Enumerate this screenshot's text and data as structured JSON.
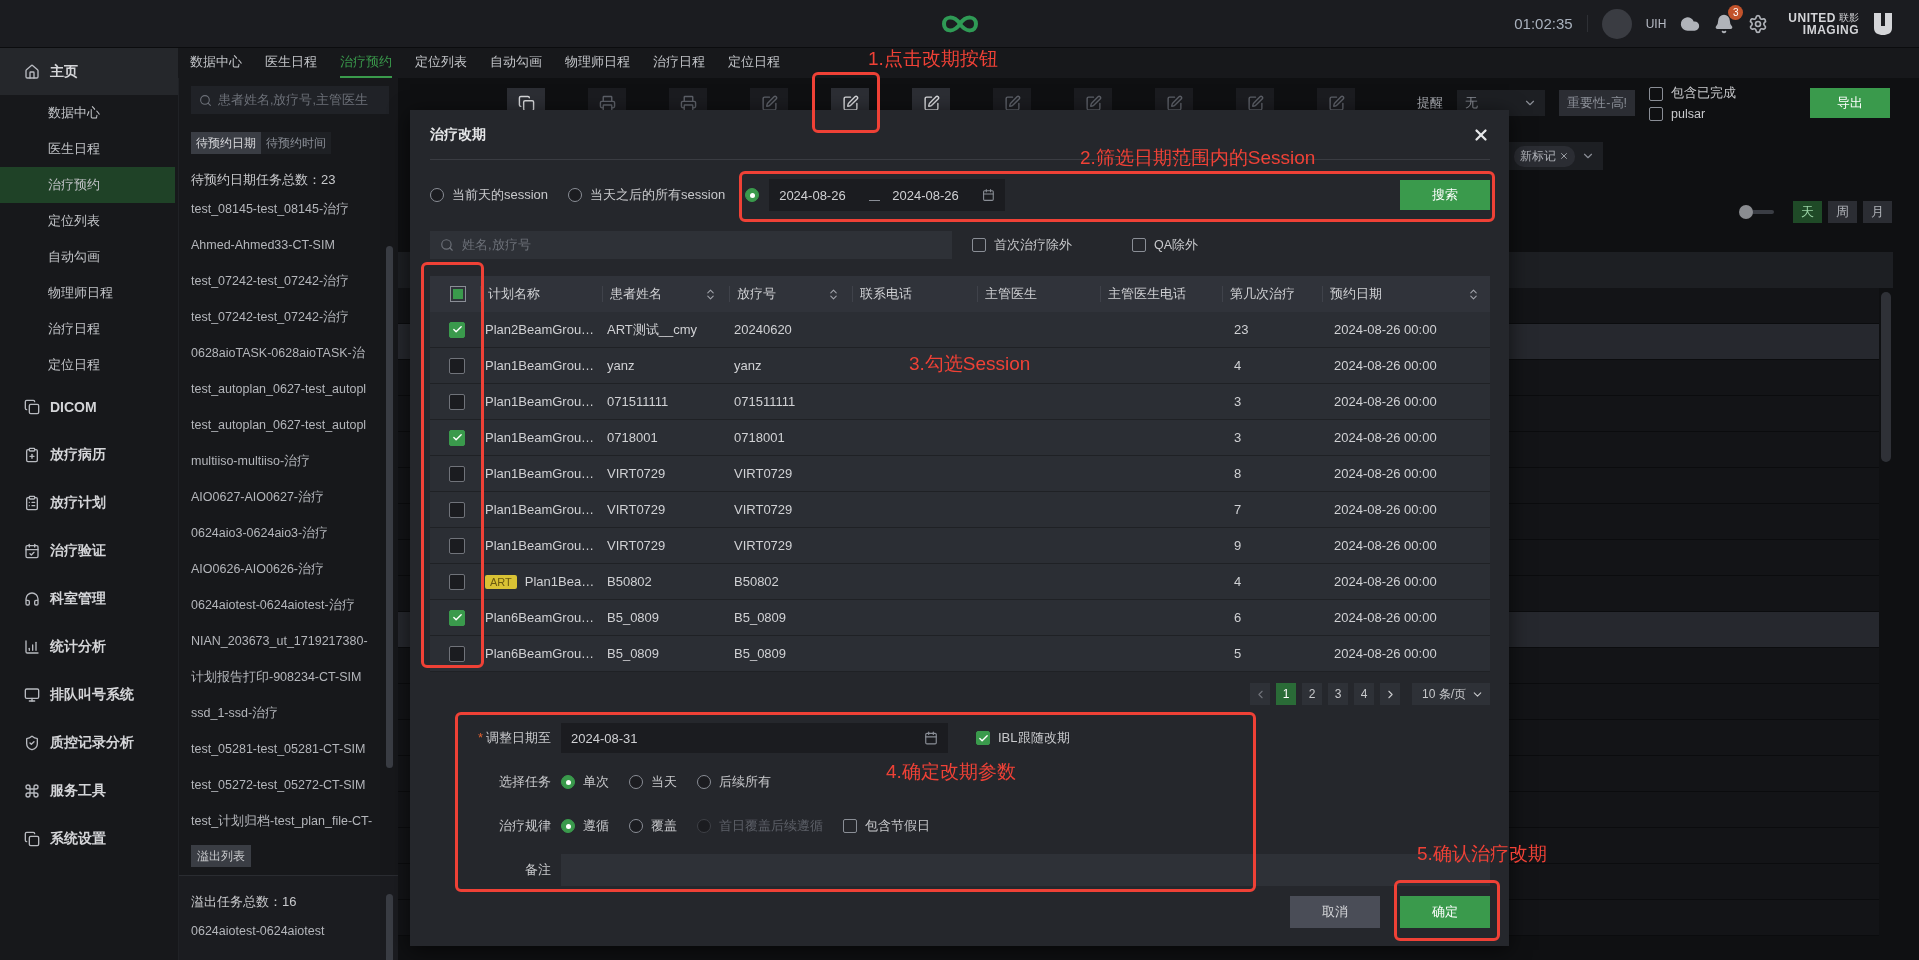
{
  "top_bar": {
    "time": "01:02:35",
    "user": "UIH",
    "notification_count": "3",
    "brand": {
      "line_1": "UNITED",
      "line_1_cn": "联影",
      "line_2": "IMAGING"
    }
  },
  "sidebar": {
    "sections": [
      {
        "label": "主页",
        "expanded": true,
        "children": [
          {
            "label": "数据中心",
            "selected": false
          },
          {
            "label": "医生日程",
            "selected": false
          },
          {
            "label": "治疗预约",
            "selected": true
          },
          {
            "label": "定位列表",
            "selected": false
          },
          {
            "label": "自动勾画",
            "selected": false
          },
          {
            "label": "物理师日程",
            "selected": false
          },
          {
            "label": "治疗日程",
            "selected": false
          },
          {
            "label": "定位日程",
            "selected": false
          }
        ]
      },
      {
        "label": "DICOM",
        "expanded": false
      },
      {
        "label": "放疗病历",
        "expanded": false
      },
      {
        "label": "放疗计划",
        "expanded": false
      },
      {
        "label": "治疗验证",
        "expanded": false
      },
      {
        "label": "科室管理",
        "expanded": false
      },
      {
        "label": "统计分析",
        "expanded": false
      },
      {
        "label": "排队叫号系统",
        "expanded": false
      },
      {
        "label": "质控记录分析",
        "expanded": false
      },
      {
        "label": "服务工具",
        "expanded": false
      },
      {
        "label": "系统设置",
        "expanded": false
      }
    ]
  },
  "module_tabs": [
    {
      "label": "数据中心",
      "selected": false
    },
    {
      "label": "医生日程",
      "selected": false
    },
    {
      "label": "治疗预约",
      "selected": true
    },
    {
      "label": "定位列表",
      "selected": false
    },
    {
      "label": "自动勾画",
      "selected": false
    },
    {
      "label": "物理师日程",
      "selected": false
    },
    {
      "label": "治疗日程",
      "selected": false
    },
    {
      "label": "定位日程",
      "selected": false
    }
  ],
  "queue": {
    "search_placeholder": "患者姓名,放疗号,主管医生",
    "tabs": [
      {
        "label": "待预约日期",
        "selected": true
      },
      {
        "label": "待预约时间",
        "selected": false
      }
    ],
    "count_label": "待预约日期任务总数：23",
    "items": [
      "test_08145-test_08145-治疗",
      "Ahmed-Ahmed33-CT-SIM",
      "test_07242-test_07242-治疗",
      "test_07242-test_07242-治疗",
      "0628aioTASK-0628aioTASK-治",
      "test_autoplan_0627-test_autopl",
      "test_autoplan_0627-test_autopl",
      "multiiso-multiiso-治疗",
      "AIO0627-AIO0627-治疗",
      "0624aio3-0624aio3-治疗",
      "AIO0626-AIO0626-治疗",
      "0624aiotest-0624aiotest-治疗",
      "NIAN_203673_ut_1719217380-",
      "计划报告打印-908234-CT-SIM",
      "ssd_1-ssd-治疗",
      "test_05281-test_05281-CT-SIM",
      "test_05272-test_05272-CT-SIM",
      "test_计划归档-test_plan_file-CT-"
    ],
    "overflow_button": "溢出列表",
    "overflow_count": "溢出任务总数：16",
    "overflow_items": [
      "0624aiotest-0624aiotest"
    ]
  },
  "toolbar": {
    "buttons": [
      {
        "kind": "copy",
        "disabled": false
      },
      {
        "kind": "print",
        "disabled": true
      },
      {
        "kind": "print",
        "disabled": true
      },
      {
        "kind": "edit",
        "disabled": true
      },
      {
        "kind": "edit",
        "disabled": false
      },
      {
        "kind": "edit",
        "disabled": false
      },
      {
        "kind": "edit",
        "disabled": true
      },
      {
        "kind": "edit",
        "disabled": true
      },
      {
        "kind": "edit",
        "disabled": true
      },
      {
        "kind": "edit",
        "disabled": true
      },
      {
        "kind": "edit",
        "disabled": true
      }
    ],
    "reminder_label": "提醒",
    "reminder_value": "无",
    "priority_button": "重要性-高!",
    "checkboxes": [
      {
        "label": "包含已完成",
        "checked": false
      },
      {
        "label": "pulsar",
        "checked": false
      }
    ],
    "export_button": "导出",
    "tag": "新标记"
  },
  "view": {
    "toggle_on": false,
    "modes": [
      {
        "label": "天",
        "selected": true
      },
      {
        "label": "周",
        "selected": false
      },
      {
        "label": "月",
        "selected": false
      }
    ]
  },
  "schedule": {
    "rows": [
      {
        "selected": false
      },
      {
        "selected": true
      },
      {
        "selected": false
      },
      {
        "selected": false
      },
      {
        "selected": false
      },
      {
        "selected": false
      },
      {
        "selected": false
      },
      {
        "selected": false
      },
      {
        "selected": false
      },
      {
        "selected": true
      },
      {
        "selected": false
      },
      {
        "selected": false
      },
      {
        "selected": false
      },
      {
        "selected": false
      },
      {
        "selected": false
      },
      {
        "selected": false
      },
      {
        "selected": false
      },
      {
        "selected": false
      }
    ]
  },
  "dialog": {
    "title": "治疗改期",
    "scope_options": [
      {
        "label": "当前天的session",
        "selected": false
      },
      {
        "label": "当天之后的所有session",
        "selected": false
      },
      {
        "selected": true
      }
    ],
    "date_range": {
      "start": "2024-08-26",
      "end": "2024-08-26"
    },
    "search_button": "搜索",
    "search_placeholder": "姓名,放疗号",
    "filters": [
      {
        "label": "首次治疗除外",
        "checked": false
      },
      {
        "label": "QA除外",
        "checked": false
      }
    ],
    "table": {
      "select_all": {
        "checked": false,
        "indeterminate": true
      },
      "columns": [
        {
          "label": "计划名称",
          "sortable": false
        },
        {
          "label": "患者姓名",
          "sortable": true
        },
        {
          "label": "放疗号",
          "sortable": true
        },
        {
          "label": "联系电话",
          "sortable": false
        },
        {
          "label": "主管医生",
          "sortable": false
        },
        {
          "label": "主管医生电话",
          "sortable": false
        },
        {
          "label": "第几次治疗",
          "sortable": false
        },
        {
          "label": "预约日期",
          "sortable": true
        }
      ],
      "rows": [
        {
          "checked": true,
          "plan": "Plan2BeamGrou…",
          "patient": "ART测试__cmy",
          "rt_id": "20240620",
          "session": "23",
          "date": "2024-08-26 00:00"
        },
        {
          "checked": false,
          "plan": "Plan1BeamGrou…",
          "patient": "yanz",
          "rt_id": "yanz",
          "session": "4",
          "date": "2024-08-26 00:00"
        },
        {
          "checked": false,
          "plan": "Plan1BeamGrou…",
          "patient": "071511111",
          "rt_id": "071511111",
          "session": "3",
          "date": "2024-08-26 00:00"
        },
        {
          "checked": true,
          "plan": "Plan1BeamGrou…",
          "patient": "0718001",
          "rt_id": "0718001",
          "session": "3",
          "date": "2024-08-26 00:00"
        },
        {
          "checked": false,
          "plan": "Plan1BeamGrou…",
          "patient": "VIRT0729",
          "rt_id": "VIRT0729",
          "session": "8",
          "date": "2024-08-26 00:00"
        },
        {
          "checked": false,
          "plan": "Plan1BeamGrou…",
          "patient": "VIRT0729",
          "rt_id": "VIRT0729",
          "session": "7",
          "date": "2024-08-26 00:00"
        },
        {
          "checked": false,
          "plan": "Plan1BeamGrou…",
          "patient": "VIRT0729",
          "rt_id": "VIRT0729",
          "session": "9",
          "date": "2024-08-26 00:00"
        },
        {
          "checked": false,
          "tag": "ART",
          "plan": "Plan1Bea…",
          "patient": "B50802",
          "rt_id": "B50802",
          "session": "4",
          "date": "2024-08-26 00:00"
        },
        {
          "checked": true,
          "plan": "Plan6BeamGrou…",
          "patient": "B5_0809",
          "rt_id": "B5_0809",
          "session": "6",
          "date": "2024-08-26 00:00"
        },
        {
          "checked": false,
          "plan": "Plan6BeamGrou…",
          "patient": "B5_0809",
          "rt_id": "B5_0809",
          "session": "5",
          "date": "2024-08-26 00:00"
        }
      ]
    },
    "pagination": {
      "pages": [
        {
          "label": "1",
          "selected": true
        },
        {
          "label": "2",
          "selected": false
        },
        {
          "label": "3",
          "selected": false
        },
        {
          "label": "4",
          "selected": false
        }
      ],
      "page_size": "10 条/页"
    },
    "form": {
      "date_label": "调整日期至",
      "required_mark": "*",
      "date_value": "2024-08-31",
      "ibl": {
        "label": "IBL跟随改期",
        "checked": true
      },
      "task_label": "选择任务",
      "task_options": [
        {
          "label": "单次",
          "selected": true,
          "disabled": false
        },
        {
          "label": "当天",
          "selected": false,
          "disabled": false
        },
        {
          "label": "后续所有",
          "selected": false,
          "disabled": false
        }
      ],
      "rule_label": "治疗规律",
      "rule_options": [
        {
          "label": "遵循",
          "selected": true,
          "disabled": false
        },
        {
          "label": "覆盖",
          "selected": false,
          "disabled": false
        },
        {
          "label": "首日覆盖后续遵循",
          "selected": false,
          "disabled": true
        }
      ],
      "holiday": {
        "label": "包含节假日",
        "checked": false
      },
      "note_label": "备注"
    },
    "cancel_button": "取消",
    "confirm_button": "确定"
  },
  "annotations": [
    {
      "text": "1.点击改期按钮"
    },
    {
      "text": "2.筛选日期范围内的Session"
    },
    {
      "text": "3.勾选Session"
    },
    {
      "text": "4.确定改期参数"
    },
    {
      "text": "5.确认治疗改期"
    }
  ]
}
